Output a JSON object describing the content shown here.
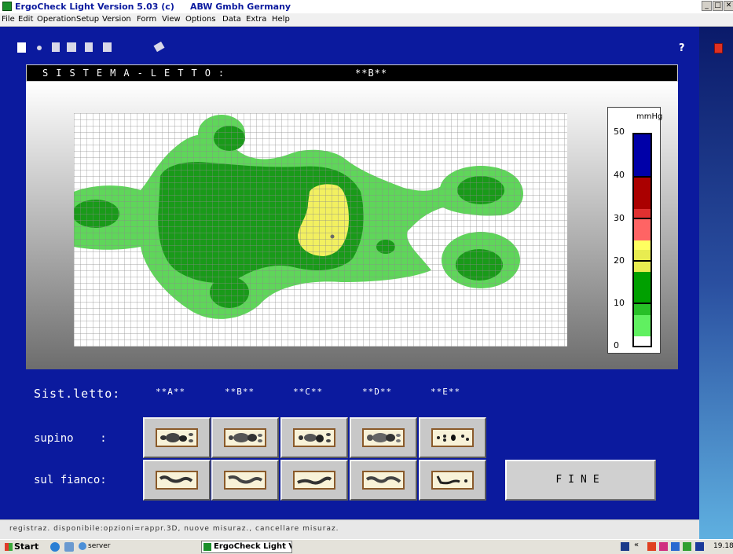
{
  "window": {
    "title": "ErgoCheck Light Version 5.03 (c)",
    "company": "ABW Gmbh Germany",
    "controls": [
      "_",
      "□",
      "✕"
    ]
  },
  "menu": [
    "File",
    "Edit",
    "Operation",
    "Setup",
    "Version",
    "Form",
    "View",
    "Options",
    "Data",
    "Extra",
    "Help"
  ],
  "toolbar": {
    "icons": [
      "square-icon",
      "dot-icon",
      "hourglass-icon",
      "printer-icon",
      "document-icon",
      "save-icon",
      "eraser-icon"
    ],
    "help_label": "?"
  },
  "header": {
    "label": "SISTEMA-LETTO:",
    "selected_system": "**B**"
  },
  "scale": {
    "unit": "mmHg",
    "labels": [
      "50",
      "40",
      "30",
      "20",
      "10",
      "0"
    ],
    "colors": [
      "#0000a8",
      "#aa0000",
      "#e03030",
      "#ff6464",
      "#ffff60",
      "#e8ec50",
      "#00a000",
      "#28c028",
      "#60f060",
      "#ffffff"
    ]
  },
  "pressure_colors": {
    "outer": "#5fd65a",
    "mid": "#199a19",
    "high": "#f2f060"
  },
  "selection": {
    "label": "Sist.letto:",
    "systems": [
      "**A**",
      "**B**",
      "**C**",
      "**D**",
      "**E**"
    ],
    "rows": [
      {
        "label": "supino    :",
        "kind": "supine"
      },
      {
        "label": "sul fianco:",
        "kind": "side"
      }
    ]
  },
  "fine_button": {
    "label": "FINE"
  },
  "status": "registraz. disponibile:opzioni=rappr.3D, nuove misuraz., cancellare misuraz.",
  "taskbar": {
    "start": "Start",
    "server": "server",
    "active_task": "ErgoCheck Light Versi...",
    "tray_chevron": "«",
    "clock": "19.18"
  }
}
